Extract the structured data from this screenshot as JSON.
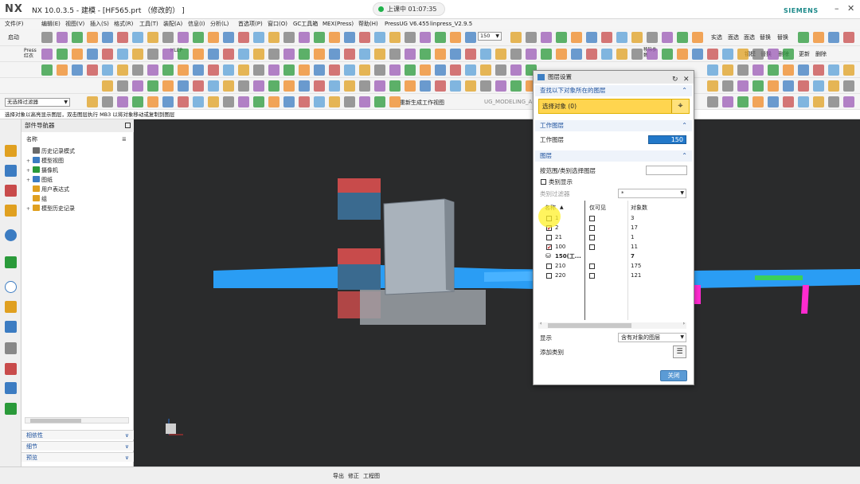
{
  "app": {
    "logo": "NX",
    "title": "NX 10.0.3.5 - 建模 - [HF565.prt （修改的） ]",
    "brand": "SIEMENS",
    "live_status": "上课中 01:07:35"
  },
  "menu": [
    "文件(F)",
    "编辑(E)",
    "视图(V)",
    "插入(S)",
    "格式(R)",
    "工具(T)",
    "装配(A)",
    "信息(I)",
    "分析(L)",
    "首选项(P)",
    "窗口(O)",
    "GC工具箱",
    "MEX(Press)",
    "帮助(H)",
    "PressUG V6.455",
    "linpress_V2.9.5"
  ],
  "toolbar": {
    "start_label": "启动",
    "layer_select": "150",
    "filter_select": "无选择过滤器",
    "regenerate_label": "重新生成工作视图",
    "buttons_row1": [
      "实选",
      "面选",
      "面选",
      "替换",
      "替换"
    ],
    "buttons_row2": [
      "移除参数",
      "更新",
      "删除",
      "钢模",
      "替换",
      "删除"
    ],
    "help_label": "HLEP",
    "press_label": "Press 红衣",
    "modeling_label": "UG_MODELING_A"
  },
  "status_line": "选择对象以高亮显示图层，双击图层执行 MB3 以将对象移动或复制到图层",
  "navigator": {
    "title": "部件导航器",
    "column_name": "名称",
    "tree": [
      {
        "label": "历史记录模式",
        "expander": "",
        "glyph": "#6b6b6b"
      },
      {
        "label": "模型视图",
        "expander": "+",
        "glyph": "#3c7cc2"
      },
      {
        "label": "摄像机",
        "expander": "+",
        "glyph": "#2a9a3a"
      },
      {
        "label": "图纸",
        "expander": "+",
        "glyph": "#3c7cc2"
      },
      {
        "label": "用户表达式",
        "expander": "",
        "glyph": "#e0a020"
      },
      {
        "label": "组",
        "expander": "",
        "glyph": "#e0a020"
      },
      {
        "label": "模型历史记录",
        "expander": "+",
        "glyph": "#e0a020"
      }
    ],
    "panels": [
      "相依性",
      "细节",
      "预览"
    ]
  },
  "bottombar": {
    "items": [
      "导出",
      "修正",
      "工程图"
    ]
  },
  "dialog": {
    "title": "图层设置",
    "section_find": "查找以下对象所在的图层",
    "select_object": "选择对象 (0)",
    "section_work": "工作图层",
    "work_layer_label": "工作图层",
    "work_layer_value": "150",
    "section_layer": "图层",
    "range_label": "按范围/类别选择图层",
    "category_display": "类别显示",
    "category_filter_label": "类别过滤器",
    "category_filter_value": "*",
    "col_name": "名称",
    "col_visible_only": "仅可见",
    "col_objects": "对象数",
    "rows": [
      {
        "name": "1",
        "checked": false,
        "visible_only": false,
        "objects": "3"
      },
      {
        "name": "2",
        "checked": true,
        "visible_only": false,
        "objects": "17"
      },
      {
        "name": "21",
        "checked": false,
        "visible_only": false,
        "objects": "1"
      },
      {
        "name": "100",
        "checked": true,
        "visible_only": false,
        "objects": "11"
      },
      {
        "name": "150(工...",
        "checked": null,
        "visible_only": null,
        "objects": "7",
        "work": true
      },
      {
        "name": "210",
        "checked": false,
        "visible_only": false,
        "objects": "175"
      },
      {
        "name": "220",
        "checked": false,
        "visible_only": false,
        "objects": "121"
      }
    ],
    "show_label": "显示",
    "show_value": "含有对象的图层",
    "add_category": "添加类别",
    "close": "关闭"
  },
  "colors": {
    "accent": "#2278c9",
    "highlight": "#ffd54f",
    "viewport_bg": "#2a2b2c",
    "plate": "#2a9df4",
    "block": "#c84b4b",
    "body": "#9aa4ae"
  }
}
